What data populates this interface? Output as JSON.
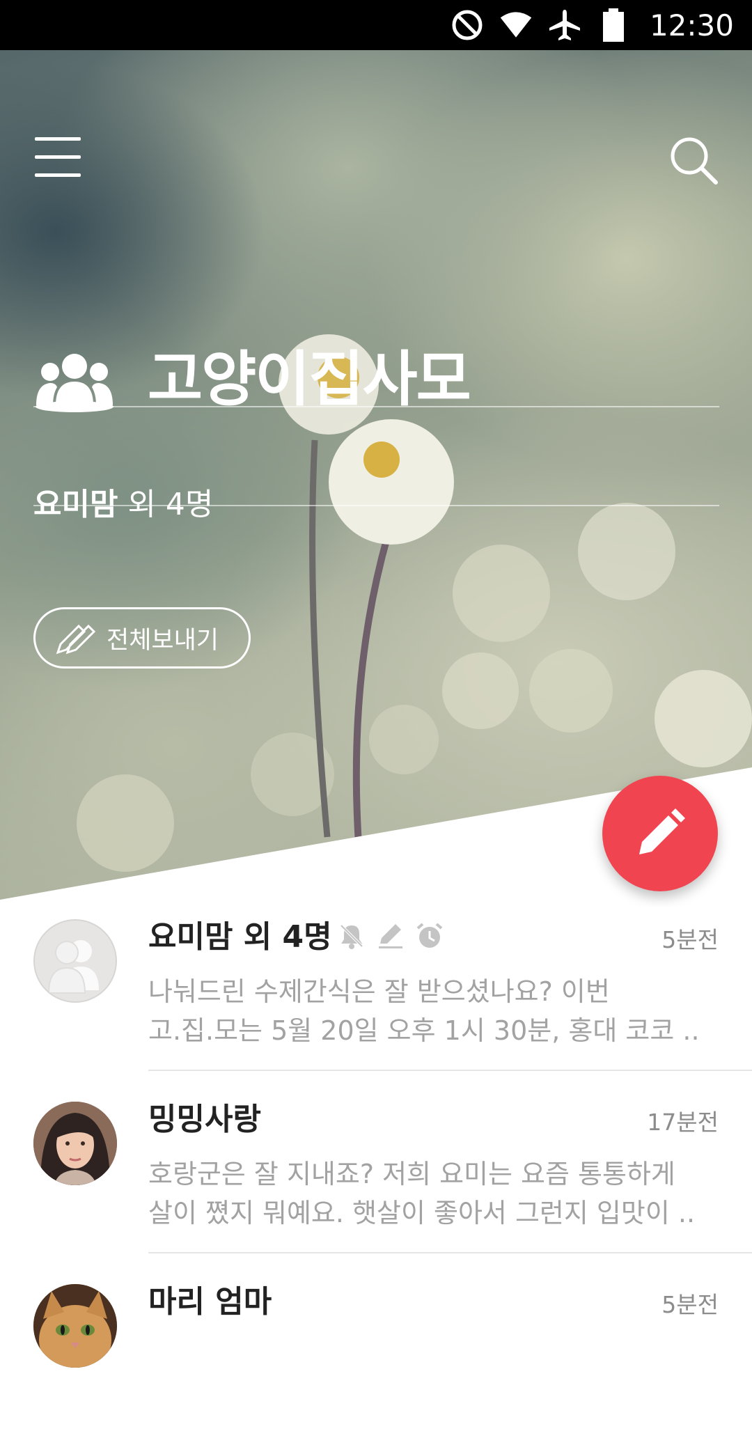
{
  "status_bar": {
    "time": "12:30",
    "icons": [
      "do-not-disturb-icon",
      "wifi-icon",
      "airplane-icon",
      "battery-icon"
    ]
  },
  "header": {
    "menu_icon": "hamburger-menu-icon",
    "search_icon": "search-icon"
  },
  "group": {
    "icon": "group-people-icon",
    "title": "고양이집사모",
    "members_lead": "요미맘",
    "members_rest": " 외 4명",
    "broadcast_label": "전체보내기"
  },
  "fab": {
    "icon": "pencil-icon",
    "accent": "#f04550"
  },
  "conversations": [
    {
      "name": "요미맘 외 4명",
      "time": "5분전",
      "avatar": "group-avatar-icon",
      "status_icons": [
        "mute-bell-icon",
        "edit-icon",
        "alarm-clock-icon"
      ],
      "preview_line1": "나눠드린 수제간식은 잘 받으셨나요? 이번",
      "preview_line2": "고.집.모는 5월 20일 오후 1시 30분, 홍대 코코 .."
    },
    {
      "name": "밍밍사랑",
      "time": "17분전",
      "avatar": "user-photo-woman",
      "preview_line1": "호랑군은 잘 지내죠? 저희 요미는 요즘 통통하게",
      "preview_line2": "살이 쪘지 뭐예요. 햇살이 좋아서 그런지 입맛이 .."
    },
    {
      "name": "마리 엄마",
      "time": "5분전",
      "avatar": "user-photo-cat"
    }
  ]
}
